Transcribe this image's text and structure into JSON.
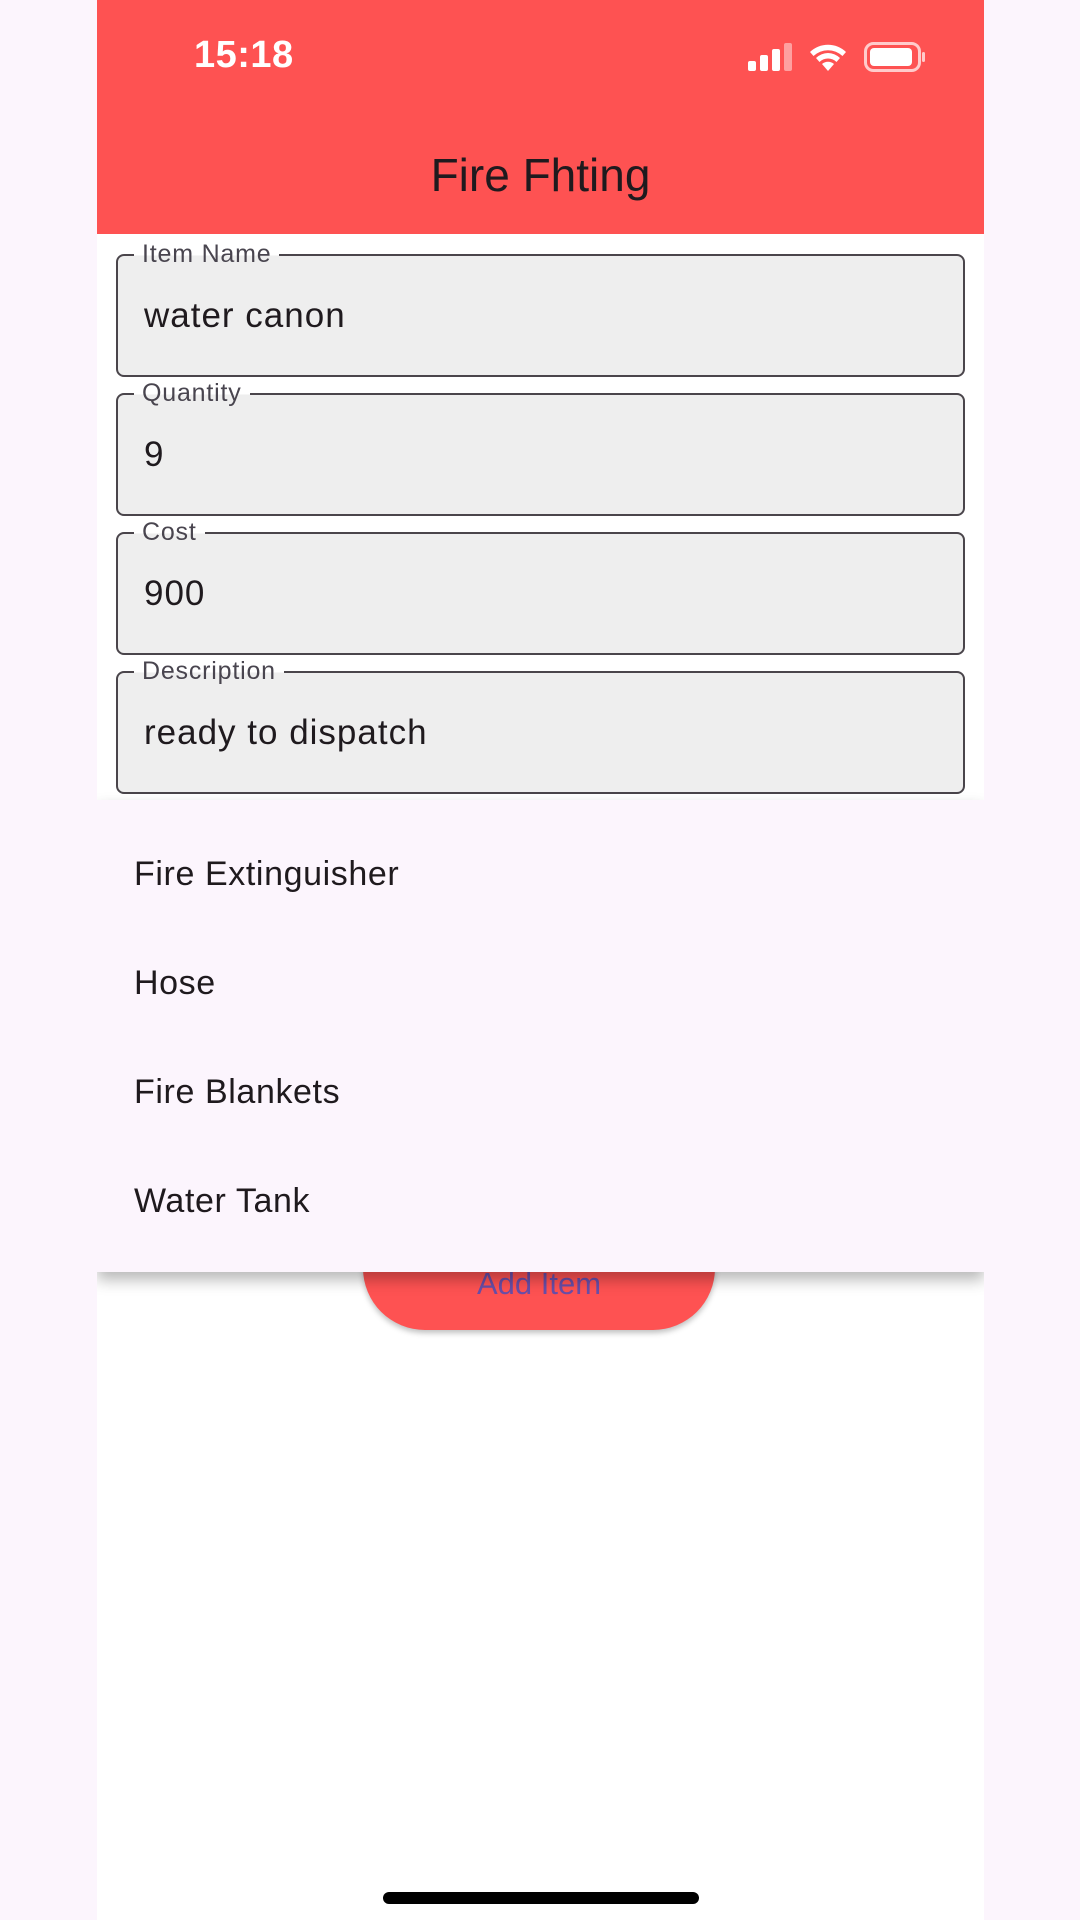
{
  "status_bar": {
    "time": "15:18",
    "icons": [
      "cellular-signal-icon",
      "wifi-icon",
      "battery-icon"
    ]
  },
  "app_bar": {
    "title": "Fire Fhting",
    "color": "#fe5252"
  },
  "form": {
    "fields": [
      {
        "label": "Item Name",
        "value": "water canon"
      },
      {
        "label": "Quantity",
        "value": "9"
      },
      {
        "label": "Cost",
        "value": "900"
      },
      {
        "label": "Description",
        "value": "ready to dispatch"
      }
    ],
    "submit_label": "Add Item"
  },
  "dropdown": {
    "options": [
      "Fire Extinguisher",
      "Hose",
      "Fire Blankets",
      "Water Tank"
    ]
  }
}
